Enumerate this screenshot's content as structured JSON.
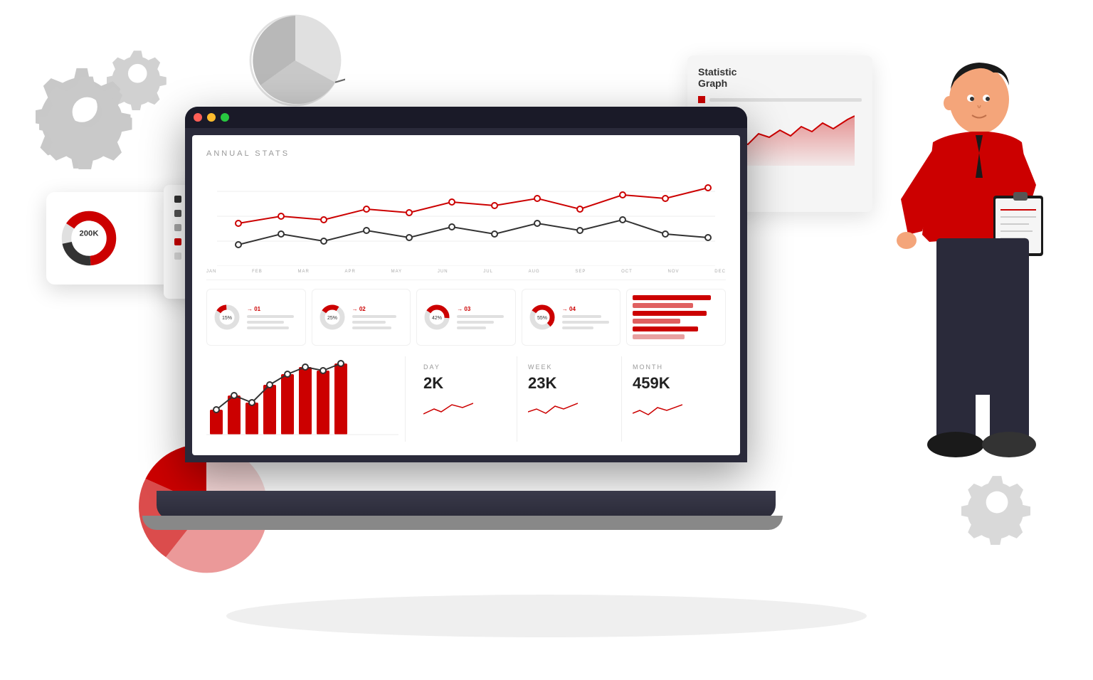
{
  "scene": {
    "background": "#ffffff"
  },
  "dashboard": {
    "title": "ANNUAL STATS",
    "months": [
      "JANUARY",
      "FEBRUARY",
      "MARCH",
      "APRIL",
      "MAY",
      "JUNE",
      "JULY",
      "AUGUST",
      "SEPTEMBER",
      "OCTOBER",
      "NOVEMBER",
      "DECEMBER"
    ],
    "months_short": [
      "JAN",
      "FEB",
      "MAR",
      "APR",
      "MAY",
      "JUN",
      "JUL",
      "AUG",
      "SEP",
      "OCT",
      "NOV",
      "DEC"
    ],
    "stat_cards": [
      {
        "id": "01",
        "percent": "15%",
        "color": "#cc0000"
      },
      {
        "id": "02",
        "percent": "25%",
        "color": "#cc0000"
      },
      {
        "id": "03",
        "percent": "42%",
        "color": "#cc0000"
      },
      {
        "id": "04",
        "percent": "55%",
        "color": "#cc0000"
      }
    ],
    "metrics": [
      {
        "period": "DAY",
        "value": "2K"
      },
      {
        "period": "WEEK",
        "value": "23K"
      },
      {
        "period": "MONTH",
        "value": "459K"
      }
    ],
    "bars": [
      3,
      5,
      4,
      7,
      9,
      11,
      10,
      12
    ],
    "donut_value": "200K",
    "donut_percent": 65
  },
  "floating_card": {
    "title_line1": "Statistic",
    "title_line2": "Graph"
  },
  "legend_items": [
    {
      "color": "#333"
    },
    {
      "color": "#cc0000"
    },
    {
      "color": "#aaa"
    }
  ],
  "titlebar_dots": [
    {
      "color": "#ff5f57"
    },
    {
      "color": "#febc2e"
    },
    {
      "color": "#28c840"
    }
  ]
}
